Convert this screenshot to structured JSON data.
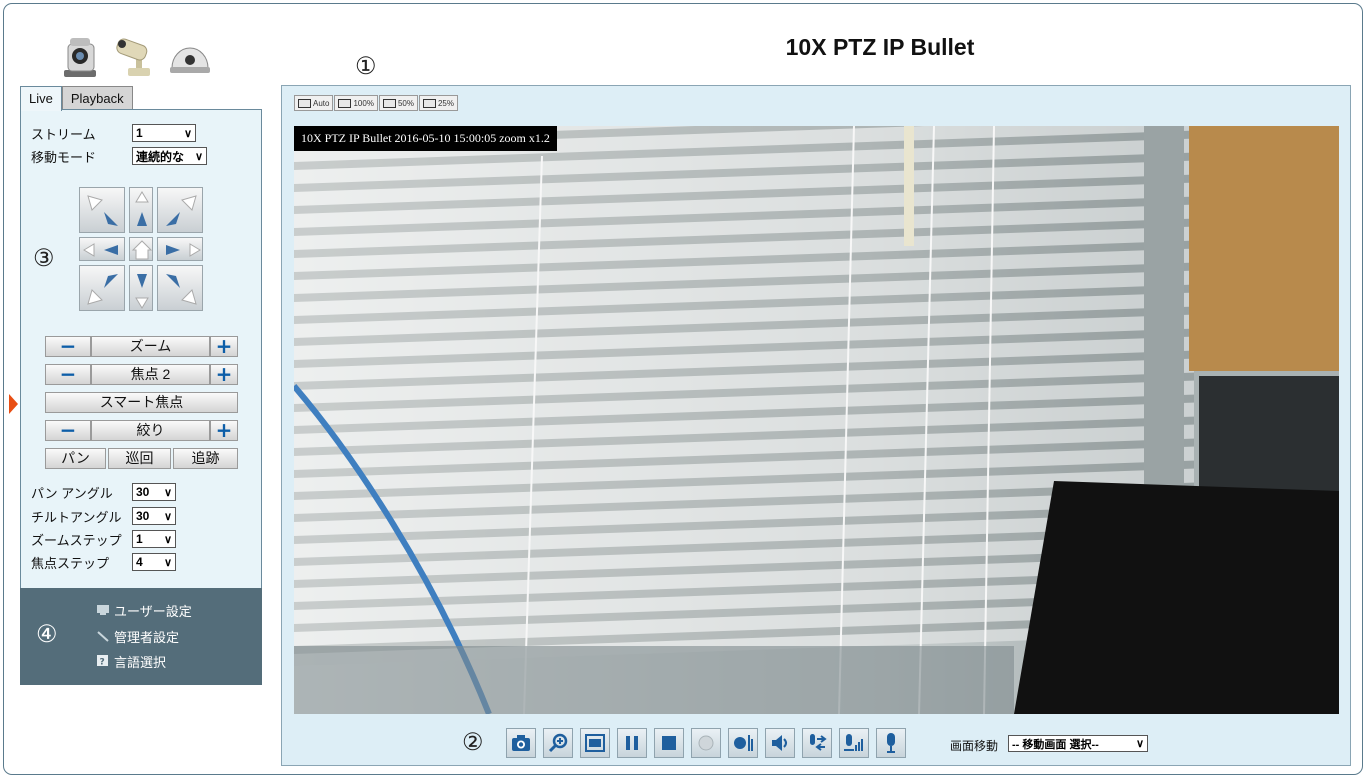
{
  "title": "10X PTZ IP Bullet",
  "tabs": [
    {
      "label": "Live",
      "active": true
    },
    {
      "label": "Playback",
      "active": false
    }
  ],
  "stream": {
    "label": "ストリーム",
    "value": "1"
  },
  "move_mode": {
    "label": "移動モード",
    "value": "連続的な"
  },
  "controls": {
    "zoom": {
      "label": "ズーム",
      "minus": "−",
      "plus": "+"
    },
    "focus": {
      "label": "焦点 2",
      "minus": "−",
      "plus": "+"
    },
    "smart_focus": "スマート焦点",
    "iris": {
      "label": "絞り",
      "minus": "−",
      "plus": "+"
    },
    "pan": "パン",
    "patrol": "巡回",
    "track": "追跡"
  },
  "steps": [
    {
      "label": "パン アングル",
      "value": "30"
    },
    {
      "label": "チルトアングル",
      "value": "30"
    },
    {
      "label": "ズームステップ",
      "value": "1"
    },
    {
      "label": "焦点ステップ",
      "value": "4"
    }
  ],
  "settings_links": [
    {
      "label": "ユーザー設定",
      "icon": "monitor-icon"
    },
    {
      "label": "管理者設定",
      "icon": "wrench-icon"
    },
    {
      "label": "言語選択",
      "icon": "help-icon"
    }
  ],
  "markers": {
    "one": "①",
    "two": "②",
    "three": "③",
    "four": "④"
  },
  "view_sizes": [
    "Auto",
    "100%",
    "50%",
    "25%"
  ],
  "osd_text": "10X PTZ IP Bullet 2016-05-10 15:00:05 zoom x1.2",
  "toolbar_icons": [
    "camera-icon",
    "zoom-in-icon",
    "fullscreen-icon",
    "pause-icon",
    "stop-icon",
    "record-icon",
    "audio-in-icon",
    "speaker-icon",
    "talk-icon",
    "volume-icon",
    "microphone-icon"
  ],
  "screen_move": {
    "label": "画面移動",
    "value": "-- 移動画面 選択--"
  },
  "colors": {
    "panel_bg": "#e8f4f9",
    "settings_bg": "#546d7a",
    "viewer_bg": "#ddeef6",
    "accent_blue": "#0d5ea8",
    "marker": "#e84e13"
  }
}
